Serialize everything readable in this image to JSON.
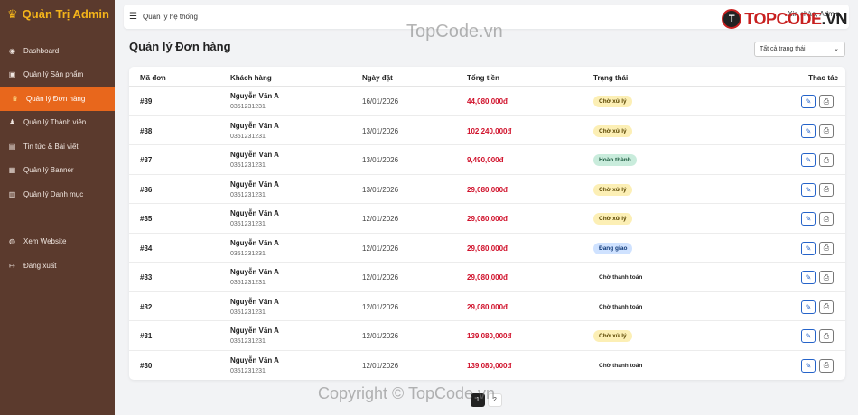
{
  "sidebar": {
    "brand": "Quản Trị Admin",
    "items": [
      {
        "label": "Dashboard",
        "icon": "dashboard-icon",
        "glyph": "◉"
      },
      {
        "label": "Quản lý Sản phẩm",
        "icon": "box-icon",
        "glyph": "▣"
      },
      {
        "label": "Quản lý Đơn hàng",
        "icon": "cart-icon",
        "glyph": "♛"
      },
      {
        "label": "Quản lý Thành viên",
        "icon": "users-icon",
        "glyph": "♟"
      },
      {
        "label": "Tin tức & Bài viết",
        "icon": "news-icon",
        "glyph": "▤"
      },
      {
        "label": "Quản lý Banner",
        "icon": "image-icon",
        "glyph": "▦"
      },
      {
        "label": "Quản lý Danh mục",
        "icon": "list-icon",
        "glyph": "▥"
      }
    ],
    "bottom_items": [
      {
        "label": "Xem Website",
        "icon": "globe-icon",
        "glyph": "◍"
      },
      {
        "label": "Đăng xuất",
        "icon": "logout-icon",
        "glyph": "↦"
      }
    ]
  },
  "topbar": {
    "title": "Quản lý hệ thống",
    "user": "Xin chào, Admin"
  },
  "logo": {
    "mark": "T",
    "text_red": "TOPCODE",
    "text_dark": ".VN"
  },
  "page": {
    "heading": "Quản lý Đơn hàng",
    "filter_label": "Tất cả trạng thái"
  },
  "table": {
    "columns": [
      "Mã đơn",
      "Khách hàng",
      "Ngày đặt",
      "Tổng tiền",
      "Trạng thái",
      "Thao tác"
    ],
    "rows": [
      {
        "id": "#39",
        "name": "Nguyễn Văn A",
        "phone": "0351231231",
        "date": "16/01/2026",
        "total": "44,080,000đ",
        "status": "Chờ xử lý",
        "status_type": "pending"
      },
      {
        "id": "#38",
        "name": "Nguyễn Văn A",
        "phone": "0351231231",
        "date": "13/01/2026",
        "total": "102,240,000đ",
        "status": "Chờ xử lý",
        "status_type": "pending"
      },
      {
        "id": "#37",
        "name": "Nguyễn Văn A",
        "phone": "0351231231",
        "date": "13/01/2026",
        "total": "9,490,000đ",
        "status": "Hoàn thành",
        "status_type": "done"
      },
      {
        "id": "#36",
        "name": "Nguyễn Văn A",
        "phone": "0351231231",
        "date": "13/01/2026",
        "total": "29,080,000đ",
        "status": "Chờ xử lý",
        "status_type": "pending"
      },
      {
        "id": "#35",
        "name": "Nguyễn Văn A",
        "phone": "0351231231",
        "date": "12/01/2026",
        "total": "29,080,000đ",
        "status": "Chờ xử lý",
        "status_type": "pending"
      },
      {
        "id": "#34",
        "name": "Nguyễn Văn A",
        "phone": "0351231231",
        "date": "12/01/2026",
        "total": "29,080,000đ",
        "status": "Đang giao",
        "status_type": "shipping"
      },
      {
        "id": "#33",
        "name": "Nguyễn Văn A",
        "phone": "0351231231",
        "date": "12/01/2026",
        "total": "29,080,000đ",
        "status": "Chờ thanh toán",
        "status_type": "unpaid"
      },
      {
        "id": "#32",
        "name": "Nguyễn Văn A",
        "phone": "0351231231",
        "date": "12/01/2026",
        "total": "29,080,000đ",
        "status": "Chờ thanh toán",
        "status_type": "unpaid"
      },
      {
        "id": "#31",
        "name": "Nguyễn Văn A",
        "phone": "0351231231",
        "date": "12/01/2026",
        "total": "139,080,000đ",
        "status": "Chờ xử lý",
        "status_type": "pending"
      },
      {
        "id": "#30",
        "name": "Nguyễn Văn A",
        "phone": "0351231231",
        "date": "12/01/2026",
        "total": "139,080,000đ",
        "status": "Chờ thanh toán",
        "status_type": "unpaid"
      }
    ]
  },
  "pagination": {
    "pages": [
      "1",
      "2"
    ],
    "current": "1"
  },
  "watermarks": {
    "top": "TopCode.vn",
    "bottom": "Copyright © TopCode.vn"
  },
  "colors": {
    "sidebar": "#5b3a2d",
    "active": "#e8671c",
    "accent_red": "#d0102a",
    "brand_gold": "#f4b41a"
  }
}
